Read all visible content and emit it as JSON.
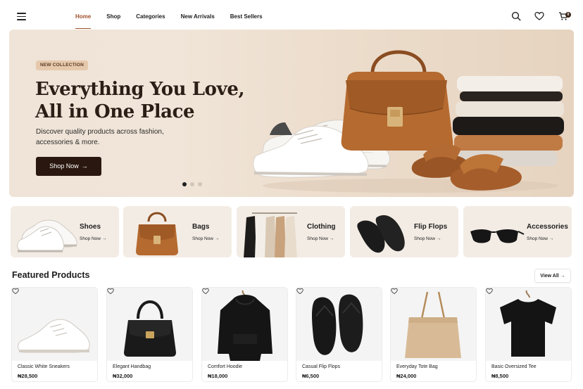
{
  "nav": {
    "items": [
      "Home",
      "Shop",
      "Categories",
      "New Arrivals",
      "Best Sellers"
    ],
    "active": "Home"
  },
  "header_icons": [
    "search-icon",
    "heart-icon",
    "cart-icon"
  ],
  "cart_count": "0",
  "hero": {
    "badge": "NEW COLLECTION",
    "title_line1": "Everything You Love,",
    "title_line2": "All in One Place",
    "subtitle": "Discover quality products across fashion, accessories & more.",
    "button": "Shop Now",
    "slides": 3,
    "active_slide": 1
  },
  "categories": [
    {
      "name": "Shoes",
      "cta": "Shop Now"
    },
    {
      "name": "Bags",
      "cta": "Shop Now"
    },
    {
      "name": "Clothing",
      "cta": "Shop Now"
    },
    {
      "name": "Flip Flops",
      "cta": "Shop Now"
    },
    {
      "name": "Accessories",
      "cta": "Shop Now"
    }
  ],
  "featured": {
    "title": "Featured Products",
    "view_all": "View All",
    "products": [
      {
        "name": "Classic White Sneakers",
        "price": "₦28,500"
      },
      {
        "name": "Elegant Handbag",
        "price": "₦32,000"
      },
      {
        "name": "Comfort Hoodie",
        "price": "₦18,000"
      },
      {
        "name": "Casual Flip Flops",
        "price": "₦6,500"
      },
      {
        "name": "Everyday Tote Bag",
        "price": "₦24,000"
      },
      {
        "name": "Basic Oversized Tee",
        "price": "₦8,500"
      }
    ]
  },
  "colors": {
    "accent": "#a0522d",
    "dark_button": "#2a1810",
    "hero_bg": "#efe4d7",
    "category_bg": "#f3ece4"
  }
}
